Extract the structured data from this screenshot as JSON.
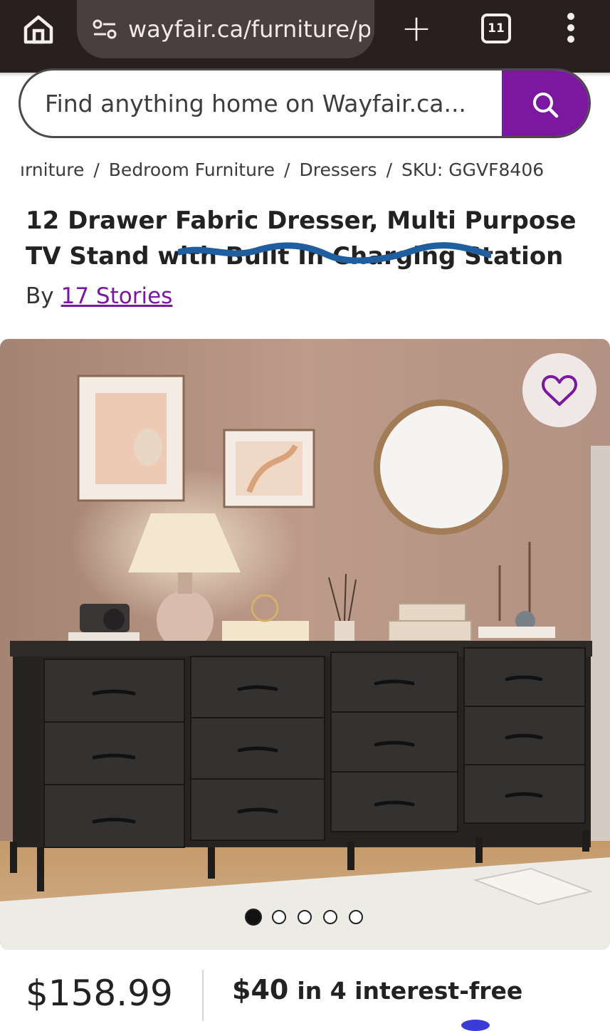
{
  "browser": {
    "url": "wayfair.ca/furniture/p",
    "tab_count": "11",
    "icons": {
      "home": "home-icon",
      "site_info": "site-settings-icon",
      "new_tab": "plus-icon",
      "tabs": "tab-switcher-icon",
      "menu": "more-vert-icon"
    },
    "bar_color": "#2a1f1f"
  },
  "search": {
    "placeholder": "Find anything home on Wayfair.ca...",
    "icon": "search-icon",
    "button_color": "#7b189f"
  },
  "breadcrumb": {
    "items": [
      "ırniture",
      "Bedroom Furniture",
      "Dressers",
      "SKU: GGVF8406"
    ],
    "separator": "/"
  },
  "product": {
    "title_visible": "12 Drawer Fabric Dresser, Multi Purpose TV Stand wit",
    "title_obscured": "h Built In Charging Station",
    "by_label": "By",
    "brand": "17 Stories",
    "accent_color": "#7b189f",
    "image": {
      "description_icon": "product-photo",
      "favorite_icon": "heart-icon",
      "slide_count": 5,
      "active_slide": 1
    }
  },
  "pricing": {
    "price": "$158.99",
    "installment_amount": "$40",
    "installment_text": "in 4 interest-free"
  }
}
